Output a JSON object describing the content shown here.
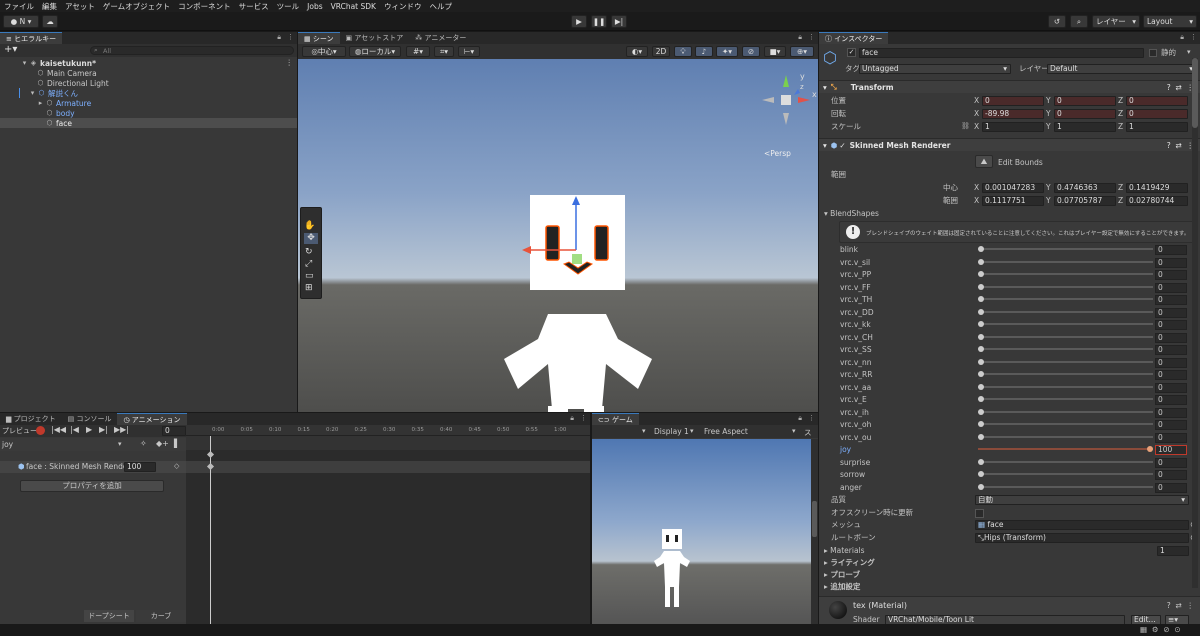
{
  "menu": [
    "ファイル",
    "編集",
    "アセット",
    "ゲームオブジェクト",
    "コンポーネント",
    "サービス",
    "ツール",
    "Jobs",
    "VRChat SDK",
    "ウィンドウ",
    "ヘルプ"
  ],
  "toolbar": {
    "account": "N ▾",
    "layers": "レイヤー",
    "layout": "Layout"
  },
  "hierarchy": {
    "tab": "ヒエラルキー",
    "search_placeholder": "All",
    "scene": "kaisetukunn*",
    "items": [
      "Main Camera",
      "Directional Light",
      "解説くん",
      "Armature",
      "body",
      "face"
    ]
  },
  "scene": {
    "tabs": [
      "シーン",
      "アセットストア",
      "アニメーター"
    ],
    "pivot": "中心",
    "space": "ローカル",
    "mode2d": "2D",
    "persp": "<Persp"
  },
  "animation": {
    "tabs": [
      "プロジェクト",
      "コンソール",
      "アニメーション"
    ],
    "preview": "プレビュー",
    "frame": "0",
    "clip": "joy",
    "property": "face : Skinned Mesh Rende",
    "property_value": "100",
    "add_property": "プロパティを追加",
    "dopesheet": "ドープシート",
    "curves": "カーブ",
    "ticks": [
      "0:00",
      "0:05",
      "0:10",
      "0:15",
      "0:20",
      "0:25",
      "0:30",
      "0:35",
      "0:40",
      "0:45",
      "0:50",
      "0:55",
      "1:00"
    ]
  },
  "game": {
    "tab": "ゲーム",
    "display": "Display 1",
    "aspect": "Free Aspect",
    "scale": "スケ"
  },
  "inspector": {
    "tab": "インスペクター",
    "name": "face",
    "static": "静的",
    "tag_label": "タグ",
    "tag": "Untagged",
    "layer_label": "レイヤー",
    "layer": "Default",
    "transform": {
      "title": "Transform",
      "position_label": "位置",
      "rotation_label": "回転",
      "scale_label": "スケール",
      "position": [
        "0",
        "0",
        "0"
      ],
      "rotation": [
        "-89.98",
        "0",
        "0"
      ],
      "scale": [
        "1",
        "1",
        "1"
      ]
    },
    "smr": {
      "title": "Skinned Mesh Renderer",
      "edit_bounds": "Edit Bounds",
      "bounds_label": "範囲",
      "center_label": "中心",
      "extent_label": "範囲",
      "center": [
        "0.001047283",
        "0.4746363",
        "0.1419429"
      ],
      "extent": [
        "0.1117751",
        "0.07705787",
        "0.02780744"
      ],
      "blendshapes_label": "BlendShapes",
      "warning": "ブレンドシェイプのウェイト範囲は固定されていることに注意してください。これはプレイヤー設定で無効にすることができます。",
      "blendshapes": [
        {
          "name": "blink",
          "value": 0
        },
        {
          "name": "vrc.v_sil",
          "value": 0
        },
        {
          "name": "vrc.v_PP",
          "value": 0
        },
        {
          "name": "vrc.v_FF",
          "value": 0
        },
        {
          "name": "vrc.v_TH",
          "value": 0
        },
        {
          "name": "vrc.v_DD",
          "value": 0
        },
        {
          "name": "vrc.v_kk",
          "value": 0
        },
        {
          "name": "vrc.v_CH",
          "value": 0
        },
        {
          "name": "vrc.v_SS",
          "value": 0
        },
        {
          "name": "vrc.v_nn",
          "value": 0
        },
        {
          "name": "vrc.v_RR",
          "value": 0
        },
        {
          "name": "vrc.v_aa",
          "value": 0
        },
        {
          "name": "vrc.v_E",
          "value": 0
        },
        {
          "name": "vrc.v_ih",
          "value": 0
        },
        {
          "name": "vrc.v_oh",
          "value": 0
        },
        {
          "name": "vrc.v_ou",
          "value": 0
        },
        {
          "name": "joy",
          "value": 100
        },
        {
          "name": "surprise",
          "value": 0
        },
        {
          "name": "sorrow",
          "value": 0
        },
        {
          "name": "anger",
          "value": 0
        }
      ],
      "quality_label": "品質",
      "quality": "自動",
      "offscreen_label": "オフスクリーン時に更新",
      "mesh_label": "メッシュ",
      "mesh": "face",
      "rootbone_label": "ルートボーン",
      "rootbone": "Hips (Transform)",
      "materials_label": "Materials",
      "materials_count": "1",
      "lighting": "ライティング",
      "probes": "プローブ",
      "additional": "追加設定"
    },
    "material": {
      "name": "tex (Material)",
      "shader_label": "Shader",
      "shader": "VRChat/Mobile/Toon Lit",
      "edit": "Edit..."
    }
  }
}
